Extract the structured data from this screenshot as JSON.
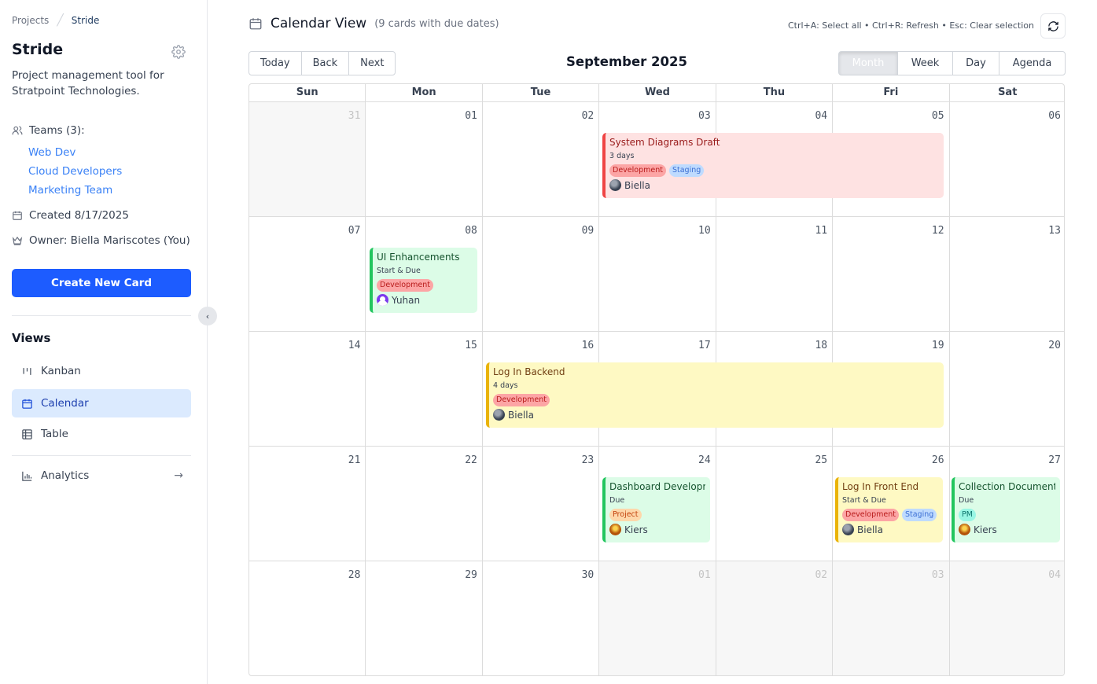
{
  "breadcrumb": {
    "root": "Projects",
    "current": "Stride"
  },
  "project": {
    "title": "Stride",
    "description": "Project management tool for Stratpoint Technologies.",
    "teams_label": "Teams (3):",
    "teams": [
      "Web Dev",
      "Cloud Developers",
      "Marketing Team"
    ],
    "created": "Created 8/17/2025",
    "owner": "Owner: Biella Mariscotes (You)"
  },
  "sidebar": {
    "create_button": "Create New Card",
    "views_heading": "Views",
    "views": [
      "Kanban",
      "Calendar",
      "Table"
    ],
    "analytics": "Analytics",
    "analytics_arrow": "→"
  },
  "header": {
    "title": "Calendar View",
    "subtitle": "(9 cards with due dates)",
    "shortcuts": "Ctrl+A: Select all • Ctrl+R: Refresh • Esc: Clear selection"
  },
  "toolbar": {
    "nav": [
      "Today",
      "Back",
      "Next"
    ],
    "month_label": "September 2025",
    "views": [
      "Month",
      "Week",
      "Day",
      "Agenda"
    ],
    "active_view": "Month"
  },
  "calendar": {
    "days_of_week": [
      "Sun",
      "Mon",
      "Tue",
      "Wed",
      "Thu",
      "Fri",
      "Sat"
    ],
    "weeks": [
      [
        "31",
        "01",
        "02",
        "03",
        "04",
        "05",
        "06"
      ],
      [
        "07",
        "08",
        "09",
        "10",
        "11",
        "12",
        "13"
      ],
      [
        "14",
        "15",
        "16",
        "17",
        "18",
        "19",
        "20"
      ],
      [
        "21",
        "22",
        "23",
        "24",
        "25",
        "26",
        "27"
      ],
      [
        "28",
        "29",
        "30",
        "01",
        "02",
        "03",
        "04"
      ]
    ],
    "events": [
      {
        "title": "System Diagrams Draft",
        "sub": "3 days",
        "tags": [
          "Development",
          "Staging"
        ],
        "user": "Biella"
      },
      {
        "title": "UI Enhancements",
        "sub": "Start & Due",
        "tags": [
          "Development"
        ],
        "user": "Yuhan"
      },
      {
        "title": "Log In Backend",
        "sub": "4 days",
        "tags": [
          "Development"
        ],
        "user": "Biella"
      },
      {
        "title": "Dashboard Development",
        "sub": "Due",
        "tags": [
          "Project"
        ],
        "user": "Kiers"
      },
      {
        "title": "Log In Front End",
        "sub": "Start & Due",
        "tags": [
          "Development",
          "Staging"
        ],
        "user": "Biella"
      },
      {
        "title": "Collection Documents",
        "sub": "Due",
        "tags": [
          "PM"
        ],
        "user": "Kiers"
      }
    ]
  },
  "colors": {
    "primary": "#1d5cff",
    "link": "#3b82f6",
    "active_nav_bg": "#dbeafe"
  }
}
